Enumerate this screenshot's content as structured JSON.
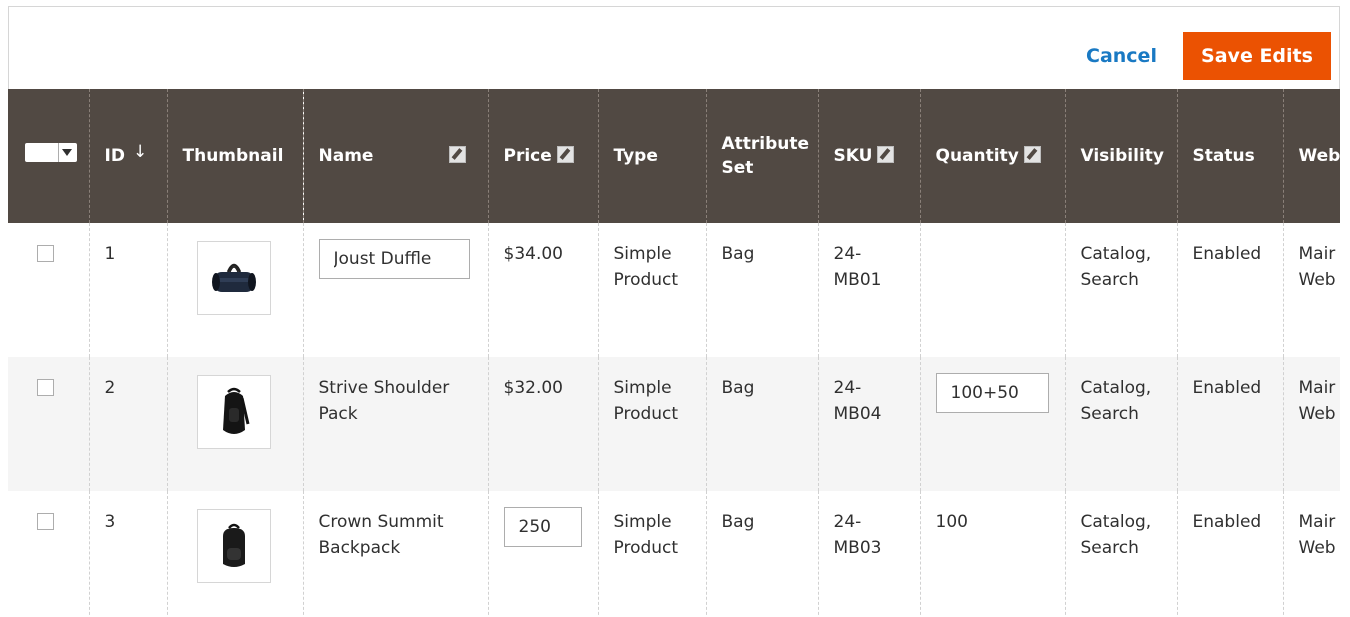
{
  "actions": {
    "cancel_label": "Cancel",
    "save_label": "Save Edits"
  },
  "columns": {
    "id": "ID",
    "id_sort": "↓",
    "thumbnail": "Thumbnail",
    "name": "Name",
    "price": "Price",
    "type": "Type",
    "attribute_set_line1": "Attribute",
    "attribute_set_line2": "Set",
    "sku": "SKU",
    "quantity": "Quantity",
    "visibility": "Visibility",
    "status": "Status",
    "websites": "Web"
  },
  "rows": [
    {
      "id": "1",
      "thumbnail_icon": "duffle-bag-icon",
      "name_value": "Joust Duffle",
      "price": "$34.00",
      "type_line1": "Simple",
      "type_line2": "Product",
      "attribute_set": "Bag",
      "sku_line1": "24-",
      "sku_line2": "MB01",
      "quantity": "",
      "visibility_line1": "Catalog,",
      "visibility_line2": "Search",
      "status": "Enabled",
      "websites_line1": "Mair",
      "websites_line2": "Web"
    },
    {
      "id": "2",
      "thumbnail_icon": "shoulder-pack-icon",
      "name_line1": "Strive Shoulder",
      "name_line2": "Pack",
      "price": "$32.00",
      "type_line1": "Simple",
      "type_line2": "Product",
      "attribute_set": "Bag",
      "sku_line1": "24-",
      "sku_line2": "MB04",
      "quantity_value": "100+50",
      "visibility_line1": "Catalog,",
      "visibility_line2": "Search",
      "status": "Enabled",
      "websites_line1": "Mair",
      "websites_line2": "Web"
    },
    {
      "id": "3",
      "thumbnail_icon": "backpack-icon",
      "name_line1": "Crown Summit",
      "name_line2": "Backpack",
      "price_value": "250",
      "type_line1": "Simple",
      "type_line2": "Product",
      "attribute_set": "Bag",
      "sku_line1": "24-",
      "sku_line2": "MB03",
      "quantity": "100",
      "visibility_line1": "Catalog,",
      "visibility_line2": "Search",
      "status": "Enabled",
      "websites_line1": "Mair",
      "websites_line2": "Web"
    }
  ],
  "colors": {
    "header_bg": "#514943",
    "accent": "#eb5202",
    "link": "#1979c3"
  }
}
